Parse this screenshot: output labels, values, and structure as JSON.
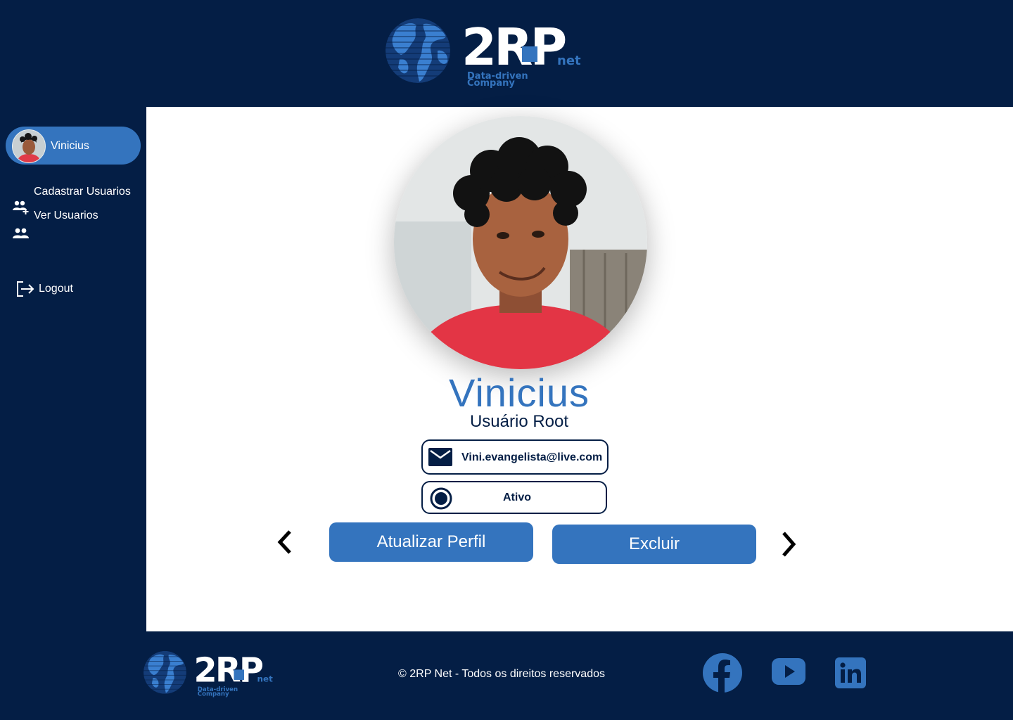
{
  "brand": {
    "logo_text": "2RP",
    "logo_suffix": "net",
    "tagline": "Data-driven Company"
  },
  "sidebar": {
    "user_name": "Vinicius",
    "items": [
      {
        "label": "Cadastrar Usuarios",
        "icon": "add-user-icon"
      },
      {
        "label": "Ver Usuarios",
        "icon": "users-icon"
      }
    ],
    "logout_label": "Logout",
    "logout_icon": "logout-icon"
  },
  "profile": {
    "name": "Vinicius",
    "role": "Usuário Root",
    "email": "Vini.evangelista@live.com",
    "status": "Ativo"
  },
  "actions": {
    "update_label": "Atualizar Perfil",
    "delete_label": "Excluir"
  },
  "footer": {
    "copyright": "© 2RP Net - Todos os direitos reservados",
    "social": [
      "facebook-icon",
      "youtube-icon",
      "linkedin-icon"
    ]
  },
  "colors": {
    "navy": "#041e45",
    "accent": "#3474be",
    "white": "#ffffff"
  }
}
